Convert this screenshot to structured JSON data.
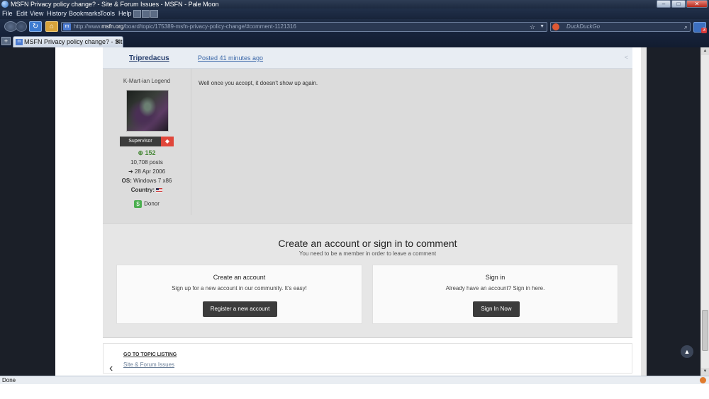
{
  "window": {
    "title": "MSFN Privacy policy change? - Site & Forum Issues - MSFN - Pale Moon",
    "min": "–",
    "max": "□",
    "close": "✕"
  },
  "menu": {
    "file": "File",
    "edit": "Edit",
    "view": "View",
    "history": "History",
    "bookmarks": "Bookmarks",
    "tools": "Tools",
    "help": "Help"
  },
  "nav": {
    "url_prefix": "http://www.",
    "url_domain": "msfn.org",
    "url_rest": "/board/topic/175389-msfn-privacy-policy-change/#comment-1121316",
    "search_placeholder": "DuckDuckGo",
    "addon_badge": "3"
  },
  "tab": {
    "title": "MSFN Privacy policy change? - Site &..."
  },
  "post": {
    "author": "Tripredacus",
    "date": "Posted 41 minutes ago",
    "rank": "K-Mart-ian Legend",
    "group": "Supervisor",
    "reputation": "152",
    "posts": "10,708 posts",
    "joined": "28 Apr 2006",
    "os_label": "OS:",
    "os_value": "Windows 7 x86",
    "country_label": "Country:",
    "donor": "Donor",
    "content": "Well once you accept, it doesn't show up again."
  },
  "signin": {
    "title": "Create an account or sign in to comment",
    "subtitle": "You need to be a member in order to leave a comment",
    "create_title": "Create an account",
    "create_desc": "Sign up for a new account in our community. It's easy!",
    "create_button": "Register a new account",
    "signin_title": "Sign in",
    "signin_desc": "Already have an account? Sign in here.",
    "signin_button": "Sign In Now"
  },
  "topicnav": {
    "go_label": "GO TO TOPIC LISTING",
    "forum_link": "Site & Forum Issues"
  },
  "status": {
    "text": "Done"
  }
}
